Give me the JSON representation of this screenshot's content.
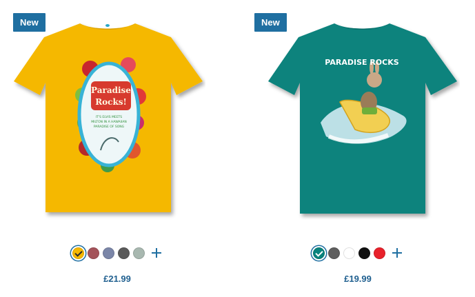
{
  "colors": {
    "badge_bg": "#1f6fa1",
    "price_text": "#1f5f8f",
    "shirt_yellow": "#f5b800",
    "shirt_teal": "#08837d"
  },
  "products": [
    {
      "badge": "New",
      "shirt_color": "#f5b800",
      "print_title": "Paradise Rocks!",
      "print_subtitle": "IT'S ELVIS MEETS MILTON IN A HAWAIIAN PARADISE OF SONG",
      "swatches": [
        {
          "color": "#f5b800",
          "selected": true
        },
        {
          "color": "#a4535a",
          "selected": false
        },
        {
          "color": "#7b86a8",
          "selected": false
        },
        {
          "color": "#5a5a5a",
          "selected": false
        },
        {
          "color": "#a8b8b0",
          "selected": false
        }
      ],
      "price": "£21.99"
    },
    {
      "badge": "New",
      "shirt_color": "#08837d",
      "print_title": "PARADISE ROCKS",
      "print_subtitle": "",
      "swatches": [
        {
          "color": "#08837d",
          "selected": true
        },
        {
          "color": "#5e5e5e",
          "selected": false
        },
        {
          "color": "#ffffff",
          "selected": false
        },
        {
          "color": "#111111",
          "selected": false
        },
        {
          "color": "#e8212b",
          "selected": false
        }
      ],
      "price": "£19.99"
    }
  ]
}
